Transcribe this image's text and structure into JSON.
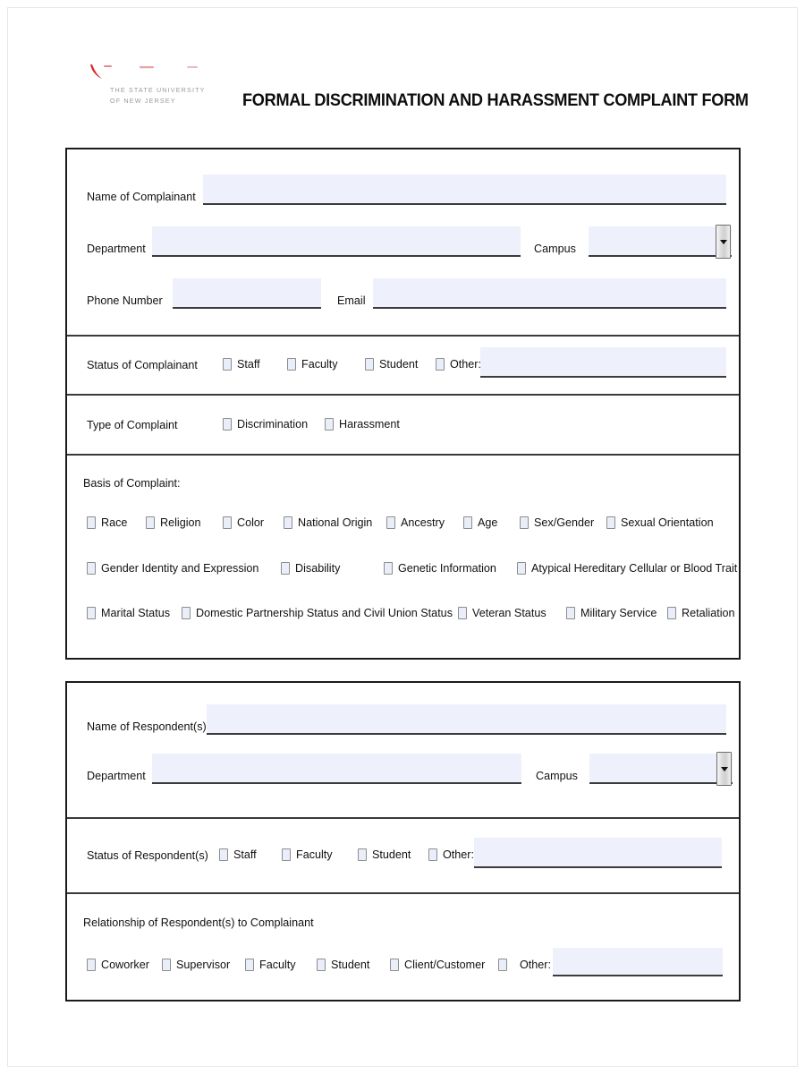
{
  "header": {
    "logo_name": "rutgers-logo",
    "logo_subtitle_line1": "THE STATE UNIVERSITY",
    "logo_subtitle_line2": "OF NEW JERSEY",
    "logo_accent_color": "#d9252a",
    "title": "FORMAL DISCRIMINATION AND HARASSMENT COMPLAINT FORM"
  },
  "colors": {
    "field_fill": "#eef1fb",
    "field_underline": "#3b3b3b",
    "block_border": "#1b1b1b",
    "logo_text": "#9a9a9a"
  },
  "complainant": {
    "name": {
      "label": "Name of Complainant",
      "value": "",
      "placeholder": ""
    },
    "department": {
      "label": "Department",
      "value": "",
      "placeholder": ""
    },
    "campus": {
      "label": "Campus",
      "value": "",
      "placeholder": "",
      "options": []
    },
    "phone": {
      "label": "Phone Number",
      "value": "",
      "placeholder": ""
    },
    "email": {
      "label": "Email",
      "value": "",
      "placeholder": ""
    },
    "status": {
      "label": "Status of Complainant",
      "options": [
        "Staff",
        "Faculty",
        "Student",
        "Other:"
      ],
      "other_value": "",
      "other_placeholder": ""
    },
    "type_of_complaint": {
      "label": "Type of Complaint",
      "options": [
        "Discrimination",
        "Harassment"
      ]
    },
    "basis": {
      "label": "Basis of Complaint:",
      "rows": [
        [
          "Race",
          "Religion",
          "Color",
          "National Origin",
          "Ancestry",
          "Age",
          "Sex/Gender",
          "Sexual Orientation"
        ],
        [
          "Gender Identity and Expression",
          "Disability",
          "Genetic Information",
          "Atypical Hereditary Cellular or Blood Trait"
        ],
        [
          "Marital Status",
          "Domestic Partnership Status and Civil Union Status",
          "Veteran Status",
          "Military Service",
          "Retaliation"
        ]
      ]
    }
  },
  "respondent": {
    "name": {
      "label": "Name of Respondent(s)",
      "value": "",
      "placeholder": ""
    },
    "department": {
      "label": "Department",
      "value": "",
      "placeholder": ""
    },
    "campus": {
      "label": "Campus",
      "value": "",
      "placeholder": "",
      "options": []
    },
    "status": {
      "label": "Status of Respondent(s)",
      "options": [
        "Staff",
        "Faculty",
        "Student",
        "Other:"
      ],
      "other_value": "",
      "other_placeholder": ""
    },
    "relationship": {
      "label": "Relationship of Respondent(s) to Complainant",
      "options": [
        "Coworker",
        "Supervisor",
        "Faculty",
        "Student",
        "Client/Customer",
        "Other:"
      ],
      "other_value": "",
      "other_placeholder": ""
    }
  }
}
